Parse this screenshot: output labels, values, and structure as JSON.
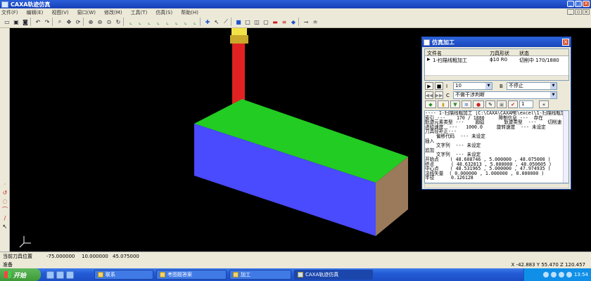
{
  "window": {
    "title": "CAXA轨迹仿真"
  },
  "menu": [
    "文件(F)",
    "编辑(E)",
    "视图(V)",
    "窗口(W)",
    "修改(M)",
    "工具(T)",
    "仿真(S)",
    "帮助(H)"
  ],
  "dialog": {
    "title": "仿真加工",
    "columns": [
      "文件名",
      "刀具形状",
      "状态"
    ],
    "rows": [
      {
        "name": "1-扫描线粗加工",
        "tool": "ϕ10 R0",
        "status": "切削中 170/1880"
      }
    ],
    "step_label": "I",
    "step_value": "10",
    "stop_label": "B",
    "stop_value": "不停止",
    "check_label": "C",
    "check_value": "不做干涉判断",
    "count_value": "1",
    "info_lines": [
      "---- 1-扫描线粗加工 [C:\\CAXA\\CAXAME\\excel\\1-扫描线粗加",
      "索引 ---    170 / 1880     障制信息 ---  存在",
      "轨迹元素类型 ---    圆弧       轨迹类型  ---    切削速",
      "进给速度  ---   1000.0     旋转速度  --- 未设定",
      "刀具径补正---",
      "    偏移代码  --- 未设定",
      "插入",
      "    文字列  --- 未设定",
      "追加",
      "    文字列  --- 未设定",
      "开始点    ( 48.608746 , 5.000000 , 48.075000 )",
      "终点      ( 48.632813 , 5.000000 , 48.050605 )",
      "中心点    ( 48.531965 , 5.000000 , 47.974935 )",
      "法线矢量  ( 0.000000 , 1.000000 , 0.000000 )",
      "半径      0.126128"
    ]
  },
  "status": {
    "position_label": "当前刀具位置",
    "x": "-75.000000",
    "y": "10.000000",
    "z": "45.075000",
    "ready": "准备",
    "coords": "X  -42.883 Y    55.470 Z   120.457"
  },
  "taskbar": {
    "start": "开始",
    "tasks": [
      "联系",
      "考图题答案",
      "加工",
      "CAXA轨迹仿真"
    ],
    "time": "13:54"
  },
  "colors": {
    "stock_front": "#4a4aff",
    "stock_top": "#22cc22",
    "stock_side": "#9a7a5a",
    "tool": "#e22222",
    "tool_holder": "#f2e24a"
  }
}
